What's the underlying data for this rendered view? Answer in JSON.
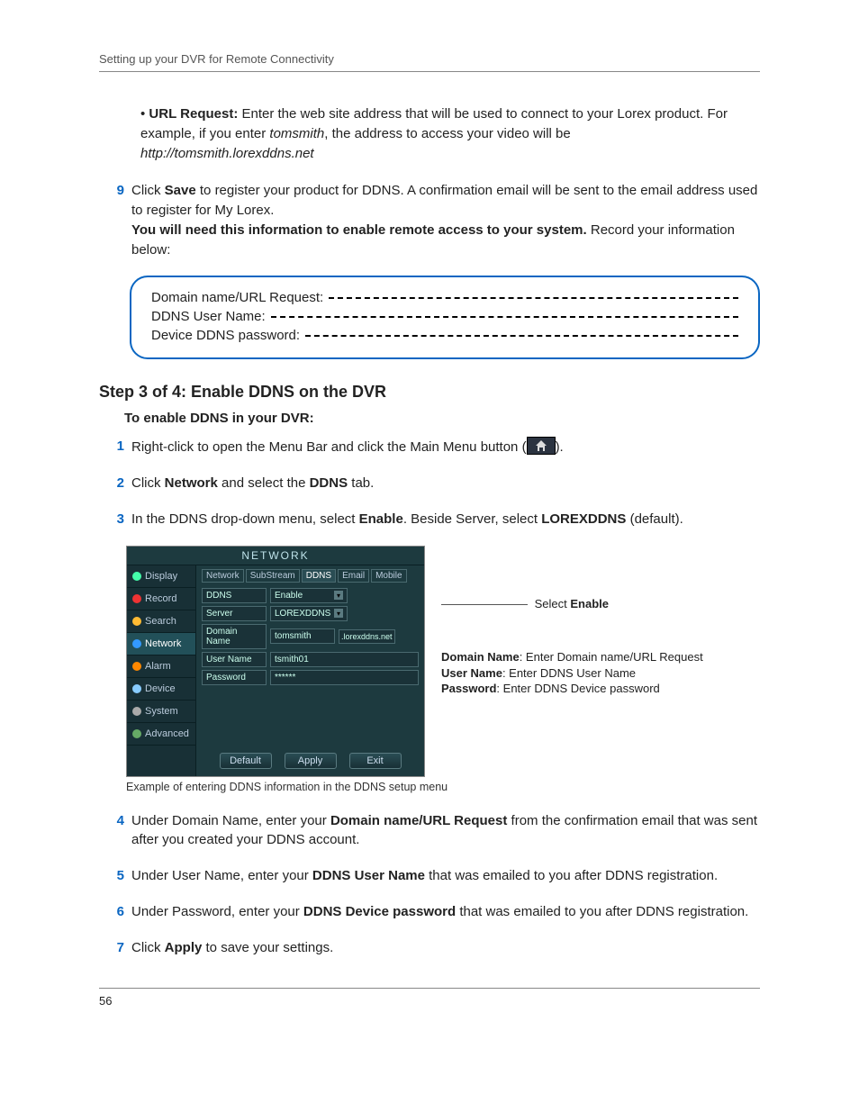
{
  "header": "Setting up your DVR for Remote Connectivity",
  "page_number": "56",
  "url_request": {
    "label": "URL Request:",
    "desc_1": " Enter the web site address that will be used to connect to your Lorex product. For example, if you enter ",
    "example_name": "tomsmith",
    "desc_2": ", the address to access your video will be ",
    "example_url": "http://tomsmith.lorexddns.net"
  },
  "step9": {
    "num": "9",
    "t1": "Click ",
    "save": "Save",
    "t2": " to register your product for DDNS. A confirmation email will be sent to the email address used to register for My Lorex.",
    "bold_line": "You will need this information to enable remote access to your system.",
    "t3": " Record your information below:"
  },
  "record_box": {
    "line1": "Domain name/URL Request:",
    "line2": "DDNS User Name:",
    "line3": "Device DDNS password:"
  },
  "step3_heading": "Step 3 of 4: Enable DDNS on the DVR",
  "step3_sub": "To enable DDNS in your DVR:",
  "s": {
    "1": {
      "num": "1",
      "a": "Right-click to open the Menu Bar and click the Main Menu button (",
      "b": ")."
    },
    "2": {
      "num": "2",
      "a": "Click ",
      "net": "Network",
      "b": " and select the ",
      "ddns": "DDNS",
      "c": " tab."
    },
    "3": {
      "num": "3",
      "a": "In the DDNS drop-down menu, select ",
      "en": "Enable",
      "b": ". Beside Server, select ",
      "lx": "LOREXDDNS",
      "c": " (default)."
    },
    "4": {
      "num": "4",
      "a": "Under Domain Name, enter your ",
      "b1": "Domain name/URL Request",
      "c": " from the confirmation email that was sent after you created your DDNS account."
    },
    "5": {
      "num": "5",
      "a": "Under User Name, enter your ",
      "b1": "DDNS User Name",
      "c": " that was emailed to you after DDNS registration."
    },
    "6": {
      "num": "6",
      "a": "Under Password, enter your ",
      "b1": "DDNS Device password",
      "c": " that was emailed to you after DDNS registration."
    },
    "7": {
      "num": "7",
      "a": "Click ",
      "b1": "Apply",
      "c": " to save your settings."
    }
  },
  "dvr": {
    "title": "NETWORK",
    "side": [
      "Display",
      "Record",
      "Search",
      "Network",
      "Alarm",
      "Device",
      "System",
      "Advanced"
    ],
    "subtabs": [
      "Network",
      "SubStream",
      "DDNS",
      "Email",
      "Mobile"
    ],
    "rows": {
      "ddns": {
        "label": "DDNS",
        "value": "Enable"
      },
      "server": {
        "label": "Server",
        "value": "LOREXDDNS"
      },
      "domain": {
        "label": "Domain Name",
        "value": "tomsmith",
        "suffix": ".lorexddns.net"
      },
      "user": {
        "label": "User Name",
        "value": "tsmith01"
      },
      "pass": {
        "label": "Password",
        "value": "******"
      }
    },
    "buttons": [
      "Default",
      "Apply",
      "Exit"
    ]
  },
  "annot": {
    "a1_pre": "Select ",
    "a1_bold": "Enable",
    "dn_label": "Domain Name",
    "dn_desc": ": Enter Domain name/URL Request",
    "un_label": "User Name",
    "un_desc": ": Enter DDNS User Name",
    "pw_label": "Password",
    "pw_desc": ": Enter DDNS Device password"
  },
  "caption": "Example of entering DDNS information in the DDNS setup menu"
}
